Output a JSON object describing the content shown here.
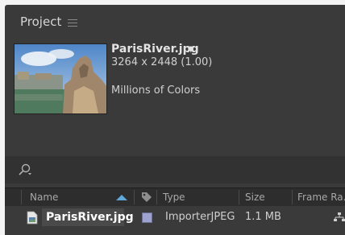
{
  "panel": {
    "title": "Project",
    "menu_icon": "hamburger-menu-icon"
  },
  "preview": {
    "filename": "ParisRiver.jpg",
    "dimensions": "3264 x 2448 (1.00)",
    "colors": "Millions of Colors",
    "dropdown_icon": "caret-down-icon"
  },
  "search": {
    "icon": "search-icon"
  },
  "columns": {
    "name": "Name",
    "type": "Type",
    "size": "Size",
    "frame_rate": "Frame Ra...",
    "label_icon": "tag-icon",
    "sort_icon": "sort-ascending-icon"
  },
  "items": [
    {
      "name": "ParisRiver.jpg",
      "type": "ImporterJPEG",
      "size": "1.1 MB",
      "label_color": "#9ea2cf"
    }
  ],
  "colors": {
    "panel_bg": "#3a3a3a",
    "accent": "#5fa8d8"
  }
}
